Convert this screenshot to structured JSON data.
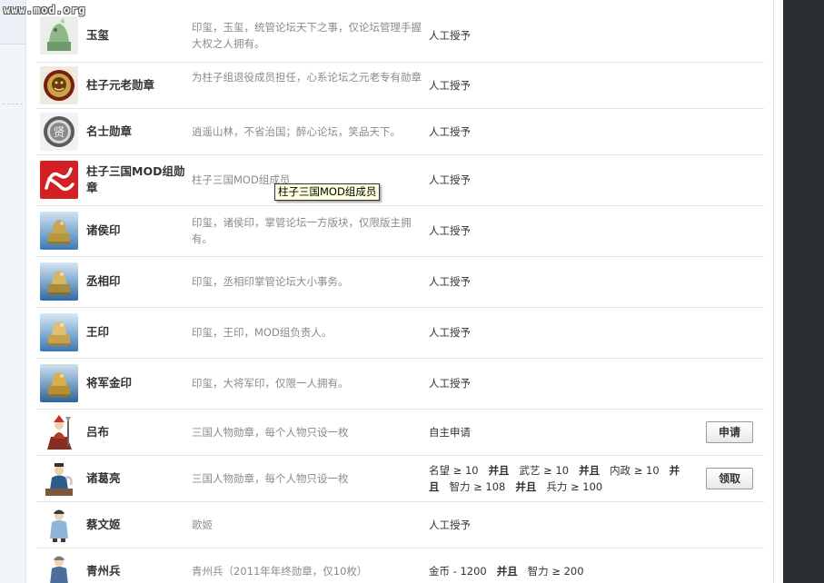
{
  "watermark": "www.mod.org",
  "tooltip": "柱子三国MOD组成员",
  "colors": {
    "name": "#333333",
    "desc": "#8a8a8a",
    "row_border": "#e2e2e2",
    "sidebar_dark": "#2a2d32"
  },
  "medals": [
    {
      "name": "玉玺",
      "desc": "印玺，玉玺，统管论坛天下之事，仅论坛管理手握大权之人拥有。",
      "cond": "人工授予",
      "icon": "jade-seal-icon"
    },
    {
      "name": "柱子元老勋章",
      "desc": "为柱子组退役成员担任，心系论坛之元老专有勋章",
      "cond": "人工授予",
      "icon": "elder-medal-icon"
    },
    {
      "name": "名士勋章",
      "desc": "逍遥山林，不省治国；醉心论坛，笑品天下。",
      "cond": "人工授予",
      "icon": "scholar-medal-icon"
    },
    {
      "name": "柱子三国MOD组勋章",
      "desc": "柱子三国MOD组成员",
      "cond": "人工授予",
      "icon": "mod-team-medal-icon"
    },
    {
      "name": "诸侯印",
      "desc": "印玺，诸侯印，掌管论坛一方版块，仅限版主拥有。",
      "cond": "人工授予",
      "icon": "lord-seal-icon"
    },
    {
      "name": "丞相印",
      "desc": "印玺，丞相印掌管论坛大小事务。",
      "cond": "人工授予",
      "icon": "chancellor-seal-icon"
    },
    {
      "name": "王印",
      "desc": "印玺，王印，MOD组负责人。",
      "cond": "人工授予",
      "icon": "king-seal-icon"
    },
    {
      "name": "将军金印",
      "desc": "印玺，大将军印，仅限一人拥有。",
      "cond": "人工授予",
      "icon": "general-gold-seal-icon"
    },
    {
      "name": "吕布",
      "desc": "三国人物勋章，每个人物只设一枚",
      "cond": "自主申请",
      "icon": "lubu-icon",
      "button": "申请"
    },
    {
      "name": "诸葛亮",
      "desc": "三国人物勋章，每个人物只设一枚",
      "cond_parts": [
        "名望 ≥ 10",
        "并且",
        "武艺 ≥ 10",
        "并且",
        "内政 ≥ 10",
        "并且",
        "智力 ≥ 108",
        "并且",
        "兵力 ≥ 100"
      ],
      "icon": "zhugeliang-icon",
      "button": "领取"
    },
    {
      "name": "蔡文姬",
      "desc": "歌姬",
      "cond": "人工授予",
      "icon": "caiwenji-icon"
    },
    {
      "name": "青州兵",
      "desc": "青州兵（2011年年终勋章，仅10枚）",
      "cond_parts": [
        "金币 - 1200",
        "并且",
        "智力 ≥ 200"
      ],
      "icon": "qingzhou-soldier-icon"
    }
  ]
}
